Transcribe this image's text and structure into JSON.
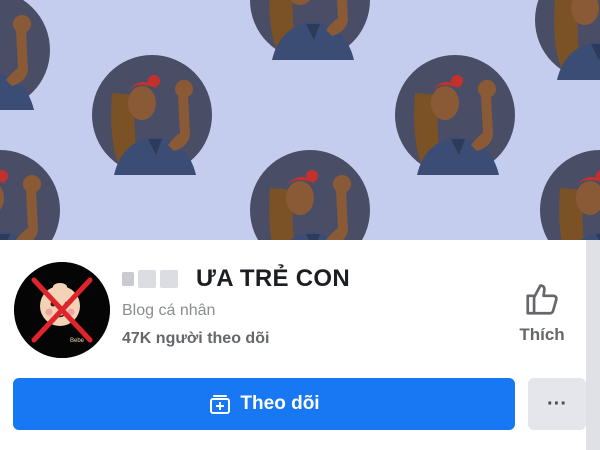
{
  "colors": {
    "cover_bg": "#c4cdee",
    "primary_blue": "#1877f2",
    "text_dark": "#1c1e21",
    "text_gray": "#65676b",
    "secondary_button": "#e4e6eb",
    "avatar_cross": "#e0242b"
  },
  "cover": {
    "pattern_icon": "flexing-woman-portrait-pattern"
  },
  "page": {
    "avatar_icon": "crossed-out-baby-avatar",
    "avatar_text": "Bebe",
    "name": "ƯA TRẺ CON",
    "category": "Blog cá nhân",
    "followers": "47K người theo dõi"
  },
  "actions": {
    "like_label": "Thích",
    "like_icon": "thumbs-up-icon",
    "follow_label": "Theo dõi",
    "follow_icon": "follow-add-icon",
    "more_label": "···"
  }
}
